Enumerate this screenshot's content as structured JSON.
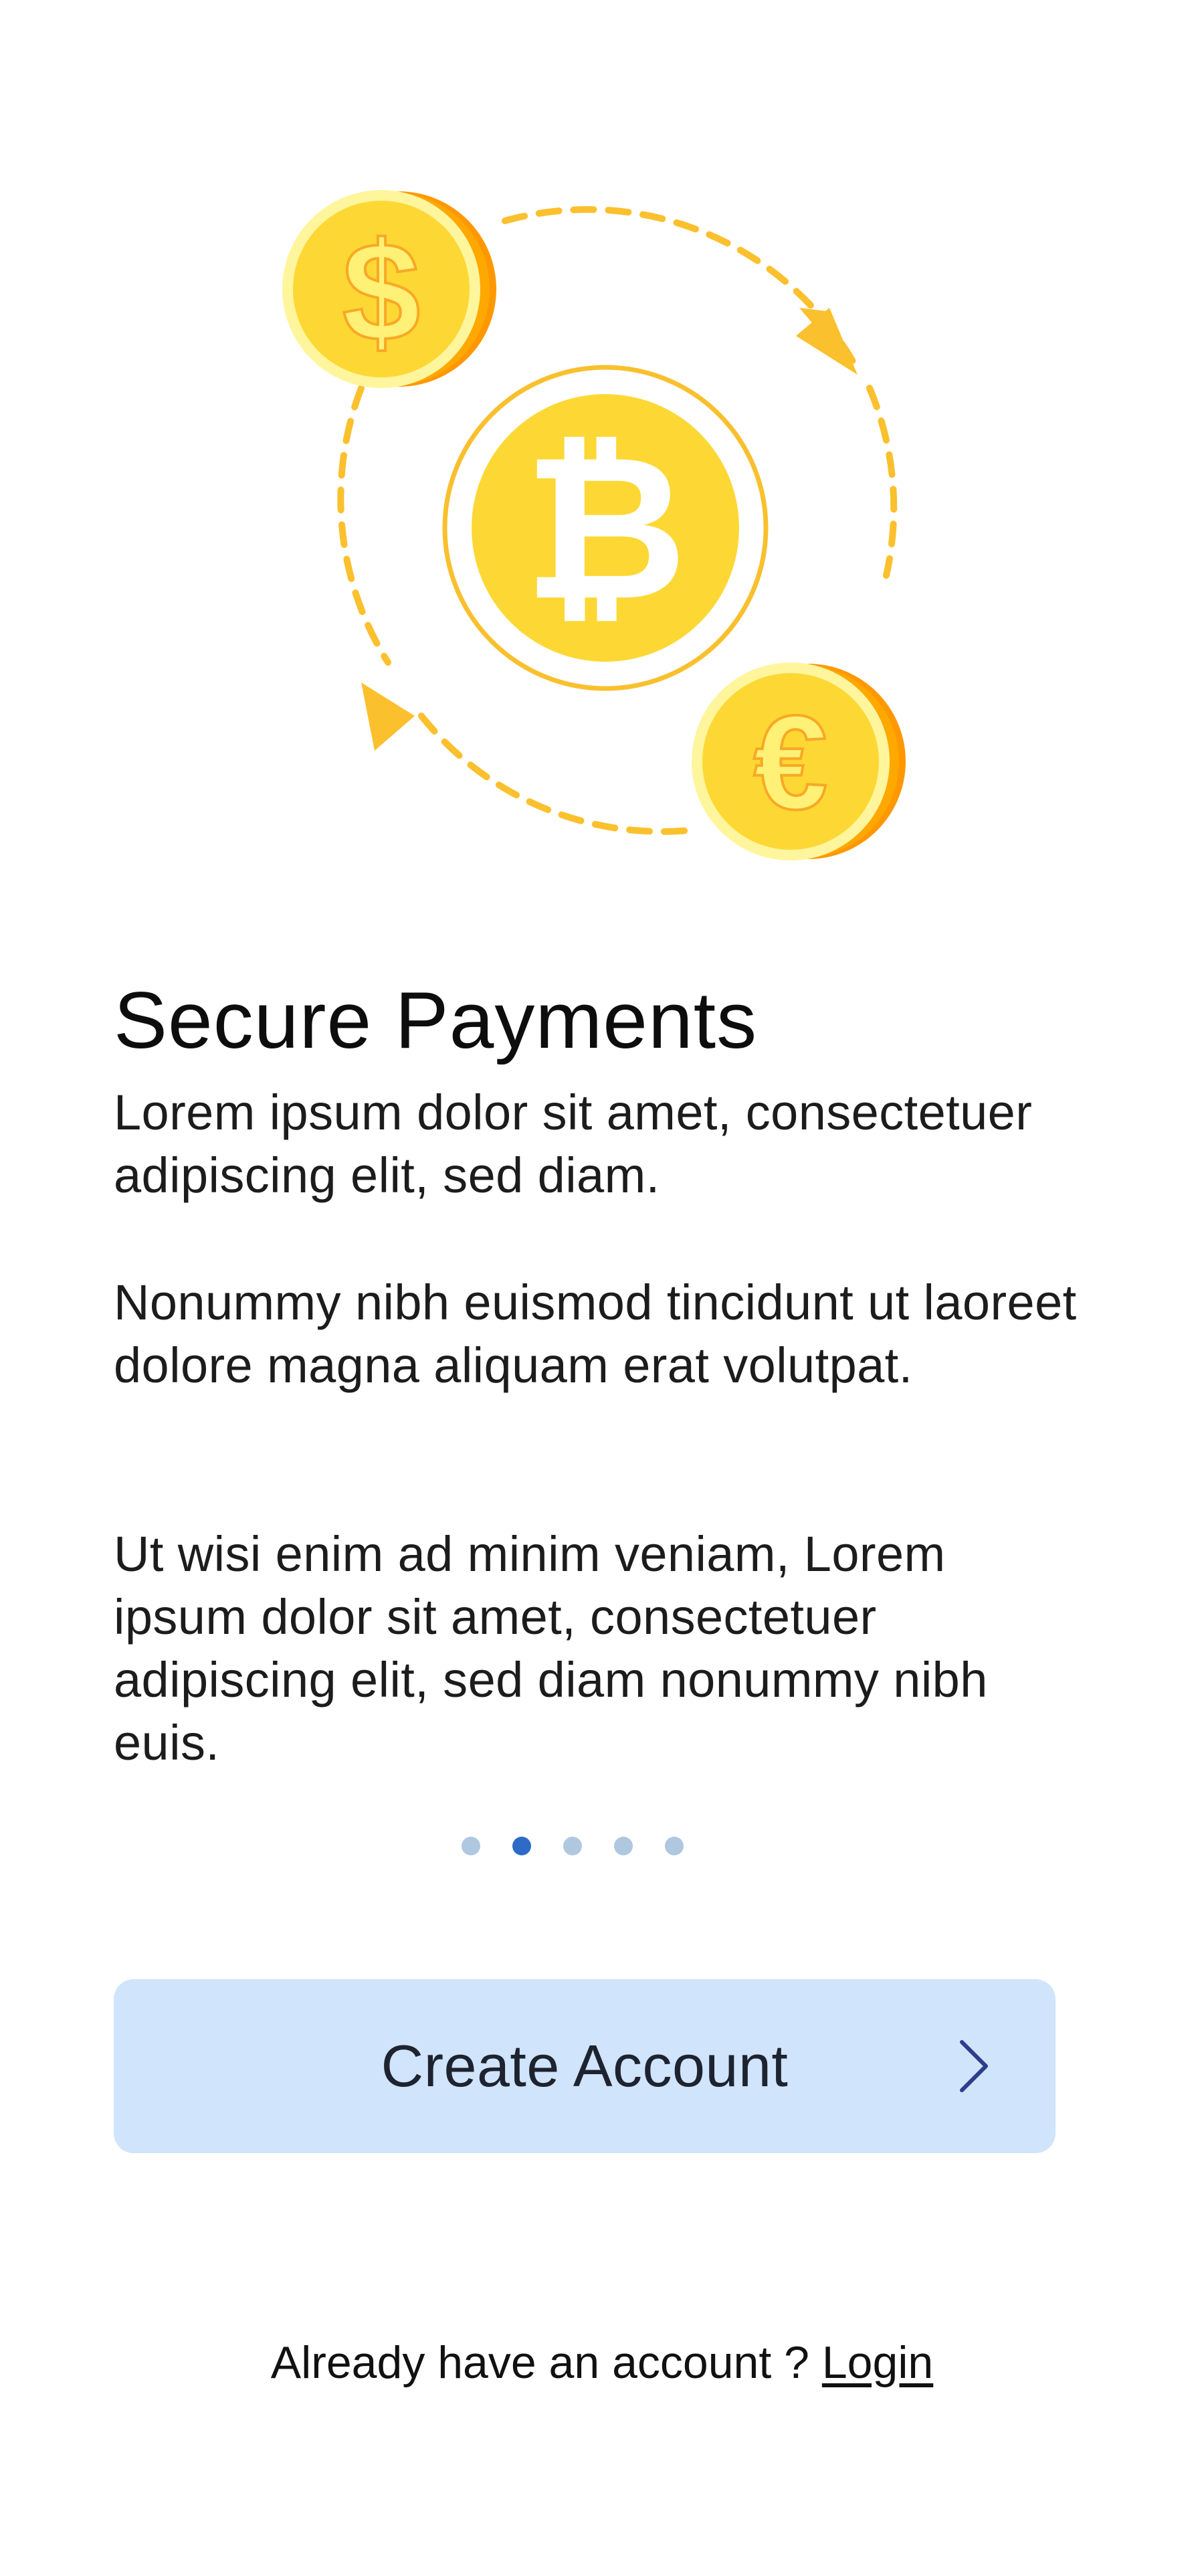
{
  "onboarding": {
    "title": "Secure Payments",
    "paragraphs": [
      "Lorem ipsum dolor sit amet, consectetuer adipiscing elit, sed diam.",
      "Nonummy nibh euismod tincidunt ut laoreet dolore magna aliquam erat volutpat.",
      "Ut wisi enim ad minim veniam, Lorem ipsum dolor sit amet, consectetuer adipiscing elit, sed diam nonummy nibh euis."
    ],
    "illustration": {
      "coin_symbols": {
        "bitcoin": "₿",
        "dollar": "$",
        "euro": "€"
      },
      "icons": [
        "bitcoin-coin-icon",
        "dollar-coin-icon",
        "euro-coin-icon",
        "exchange-arrows-icon"
      ]
    },
    "pagination": {
      "total": 5,
      "active_index": 1
    }
  },
  "actions": {
    "create_account_label": "Create Account",
    "create_account_icon": "chevron-right-icon",
    "login_prompt": "Already have an account ? ",
    "login_link": "Login"
  },
  "colors": {
    "coin_gold": "#fdd835",
    "coin_rim": "#f9a825",
    "coin_edge": "#ff9800",
    "arrow_yellow": "#fbc02d",
    "dot_active": "#2e6bc6",
    "dot_inactive": "#b0c7e0",
    "button_bg": "#d0e4fb",
    "chevron": "#2c3e8c"
  }
}
